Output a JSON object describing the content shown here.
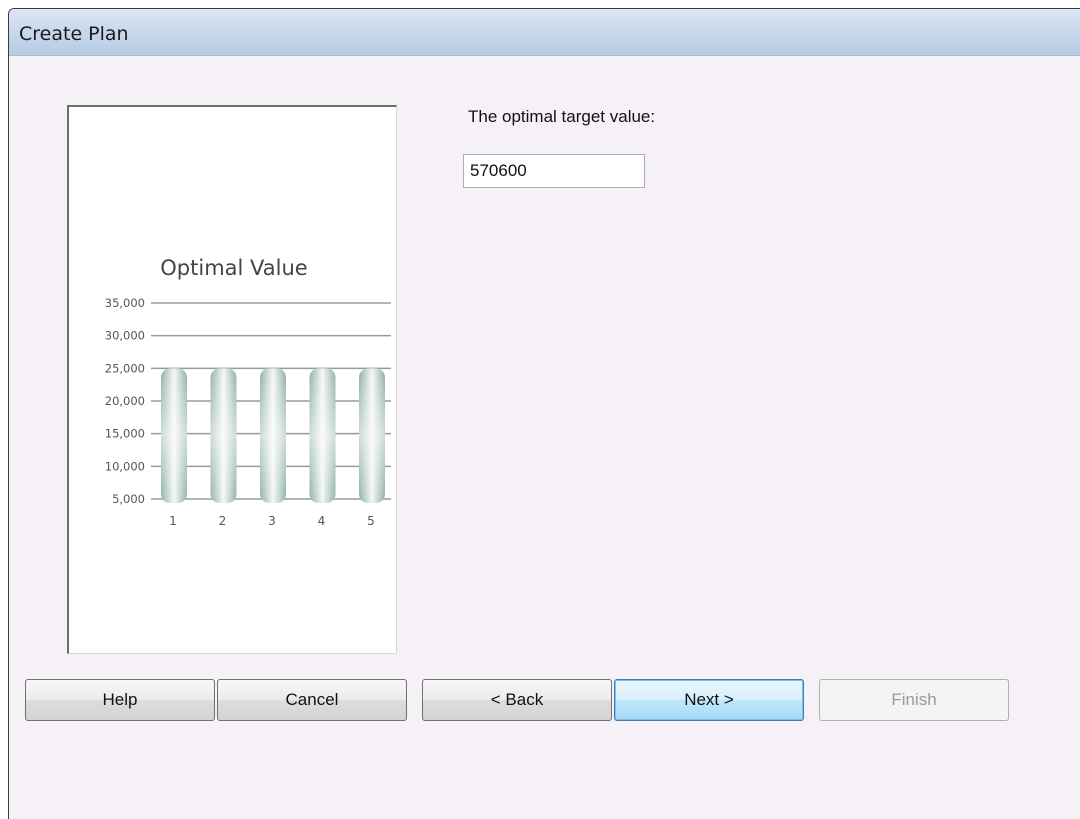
{
  "window": {
    "title": "Create Plan"
  },
  "form": {
    "prompt": "The optimal target value:",
    "value": "570600"
  },
  "buttons": {
    "help": "Help",
    "cancel": "Cancel",
    "back": "< Back",
    "next": "Next >",
    "finish": "Finish"
  },
  "colors": {
    "bar": "#a9c6c0",
    "title_bar": "#c9d8ec",
    "dialog_bg": "#f5f1f7",
    "default_button_border": "#3c7fb1"
  },
  "chart_data": {
    "type": "bar",
    "title": "Optimal Value",
    "categories": [
      "1",
      "2",
      "3",
      "4",
      "5"
    ],
    "values": [
      25000,
      25000,
      25000,
      25000,
      25000
    ],
    "y_tick_labels": [
      "35,000",
      "30,000",
      "25,000",
      "20,000",
      "15,000",
      "10,000",
      "5,000"
    ],
    "y_ticks": [
      35000,
      30000,
      25000,
      20000,
      15000,
      10000,
      5000
    ],
    "ylim": [
      5000,
      35000
    ],
    "grid": true
  }
}
